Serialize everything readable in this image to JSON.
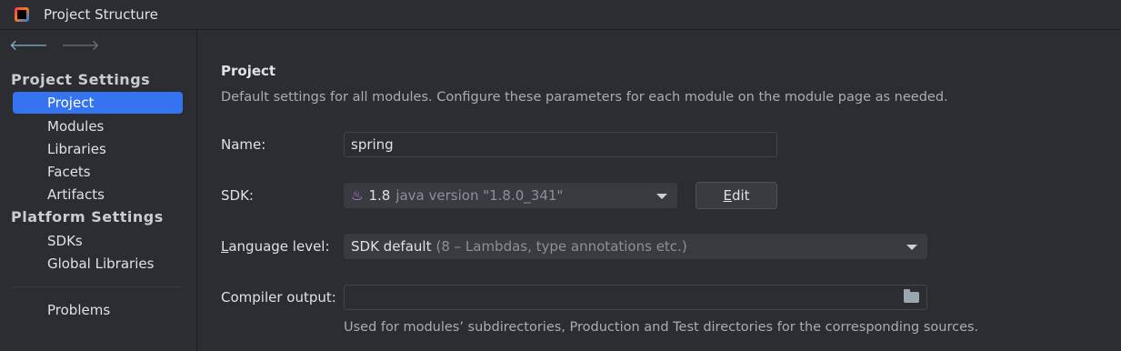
{
  "window": {
    "title": "Project Structure"
  },
  "sidebar": {
    "sections": [
      {
        "heading": "Project Settings",
        "items": [
          "Project",
          "Modules",
          "Libraries",
          "Facets",
          "Artifacts"
        ]
      },
      {
        "heading": "Platform Settings",
        "items": [
          "SDKs",
          "Global Libraries"
        ]
      }
    ],
    "problems": "Problems",
    "selected": "Project"
  },
  "main": {
    "title": "Project",
    "description": "Default settings for all modules. Configure these parameters for each module on the module page as needed.",
    "name": {
      "label": "Name:",
      "value": "spring"
    },
    "sdk": {
      "label": "SDK:",
      "version": "1.8",
      "detail": "java version \"1.8.0_341\"",
      "edit_label": "Edit",
      "edit_mnemonic": "E",
      "edit_rest": "dit"
    },
    "language_level": {
      "label_mnemonic": "L",
      "label_rest": "anguage level:",
      "value": "SDK default",
      "detail": "(8 – Lambdas, type annotations etc.)"
    },
    "compiler_output": {
      "label": "Compiler output:",
      "value": "",
      "hint": "Used for modules’ subdirectories, Production and Test directories for the corresponding sources."
    }
  },
  "colors": {
    "accent": "#3574f0",
    "background": "#2b2d30",
    "java_icon": "#c78aff"
  }
}
